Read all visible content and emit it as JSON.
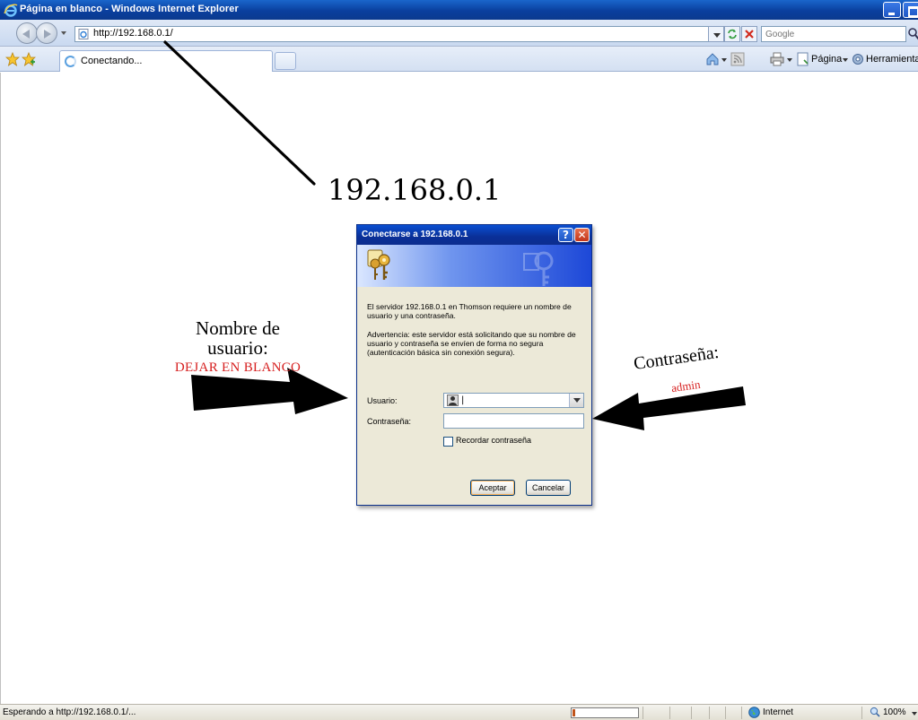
{
  "window": {
    "title": "Página en blanco - Windows Internet Explorer"
  },
  "address_bar": {
    "url": "http://192.168.0.1/",
    "search_placeholder": "Google"
  },
  "tab_bar": {
    "active_tab_label": "Conectando...",
    "commands": {
      "page_label": "Página",
      "tools_label": "Herramientas"
    }
  },
  "annotations": {
    "ip_address": "192.168.0.1",
    "username_line1": "Nombre de",
    "username_line2": "usuario:",
    "username_instruction": "DEJAR EN BLANCO",
    "password_label": "Contraseña:",
    "password_value": "admin"
  },
  "dialog": {
    "title": "Conectarse a 192.168.0.1",
    "help_label": "?",
    "close_label": "✕",
    "message": "El servidor 192.168.0.1 en Thomson requiere un nombre de usuario y una contraseña.",
    "warning": "Advertencia: este servidor está solicitando que su nombre de usuario y contraseña se envíen de forma no segura (autenticación básica sin conexión segura).",
    "username_label": "Usuario:",
    "username_value": "|",
    "password_label": "Contraseña:",
    "password_value": "",
    "remember_label": "Recordar contraseña",
    "remember_checked": false,
    "ok_label": "Aceptar",
    "cancel_label": "Cancelar"
  },
  "status_bar": {
    "status_text": "Esperando a http://192.168.0.1/...",
    "progress_fraction": 0.04,
    "zone_label": "Internet",
    "zoom_label": "100%"
  },
  "colors": {
    "annotation_red": "#d61f1f",
    "titlebar_blue": "#0a3f9e",
    "progress_orange": "#c0541a"
  }
}
